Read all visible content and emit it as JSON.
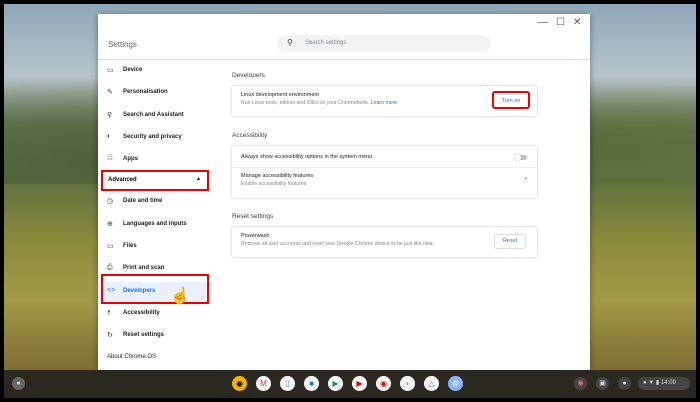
{
  "window": {
    "title": "Settings",
    "controls": {
      "minimize": "—",
      "maximize": "☐",
      "close": "✕"
    }
  },
  "search": {
    "placeholder": "Search settings",
    "icon": "search-icon"
  },
  "sidebar": {
    "items": [
      {
        "label": "Device",
        "icon": "laptop-icon"
      },
      {
        "label": "Personalisation",
        "icon": "brush-icon"
      },
      {
        "label": "Search and Assistant",
        "icon": "search-icon"
      },
      {
        "label": "Security and privacy",
        "icon": "shield-icon"
      },
      {
        "label": "Apps",
        "icon": "grid-icon"
      }
    ],
    "advanced": "Advanced",
    "advanced_items": [
      {
        "label": "Date and time",
        "icon": "clock-icon"
      },
      {
        "label": "Languages and inputs",
        "icon": "globe-icon"
      },
      {
        "label": "Files",
        "icon": "folder-icon"
      },
      {
        "label": "Print and scan",
        "icon": "printer-icon"
      },
      {
        "label": "Developers",
        "icon": "code-icon",
        "selected": true
      },
      {
        "label": "Accessibility",
        "icon": "accessibility-icon"
      },
      {
        "label": "Reset settings",
        "icon": "reset-icon"
      }
    ],
    "about": "About Chrome OS"
  },
  "main": {
    "developers": {
      "heading": "Developers",
      "title": "Linux development environment",
      "desc": "Run Linux tools, editors and IDEs on your Chromebook.",
      "link": "Learn more",
      "button": "Turn on"
    },
    "accessibility": {
      "heading": "Accessibility",
      "always_show": "Always show accessibility options in the system menu",
      "toggle_on": false,
      "manage": "Manage accessibility features",
      "manage_desc": "Enable accessibility features"
    },
    "reset": {
      "heading": "Reset settings",
      "title": "Powerwash",
      "desc": "Remove all user accounts and reset your Google Chrome device to be just like new.",
      "button": "Reset"
    }
  },
  "taskbar": {
    "apps": [
      "Chrome",
      "Gmail",
      "Docs",
      "Files",
      "Play Store",
      "YouTube",
      "YouTube Music",
      "Play Books",
      "Google Drive",
      "Settings"
    ],
    "time": "14:09"
  },
  "highlight_color": "#e00000"
}
